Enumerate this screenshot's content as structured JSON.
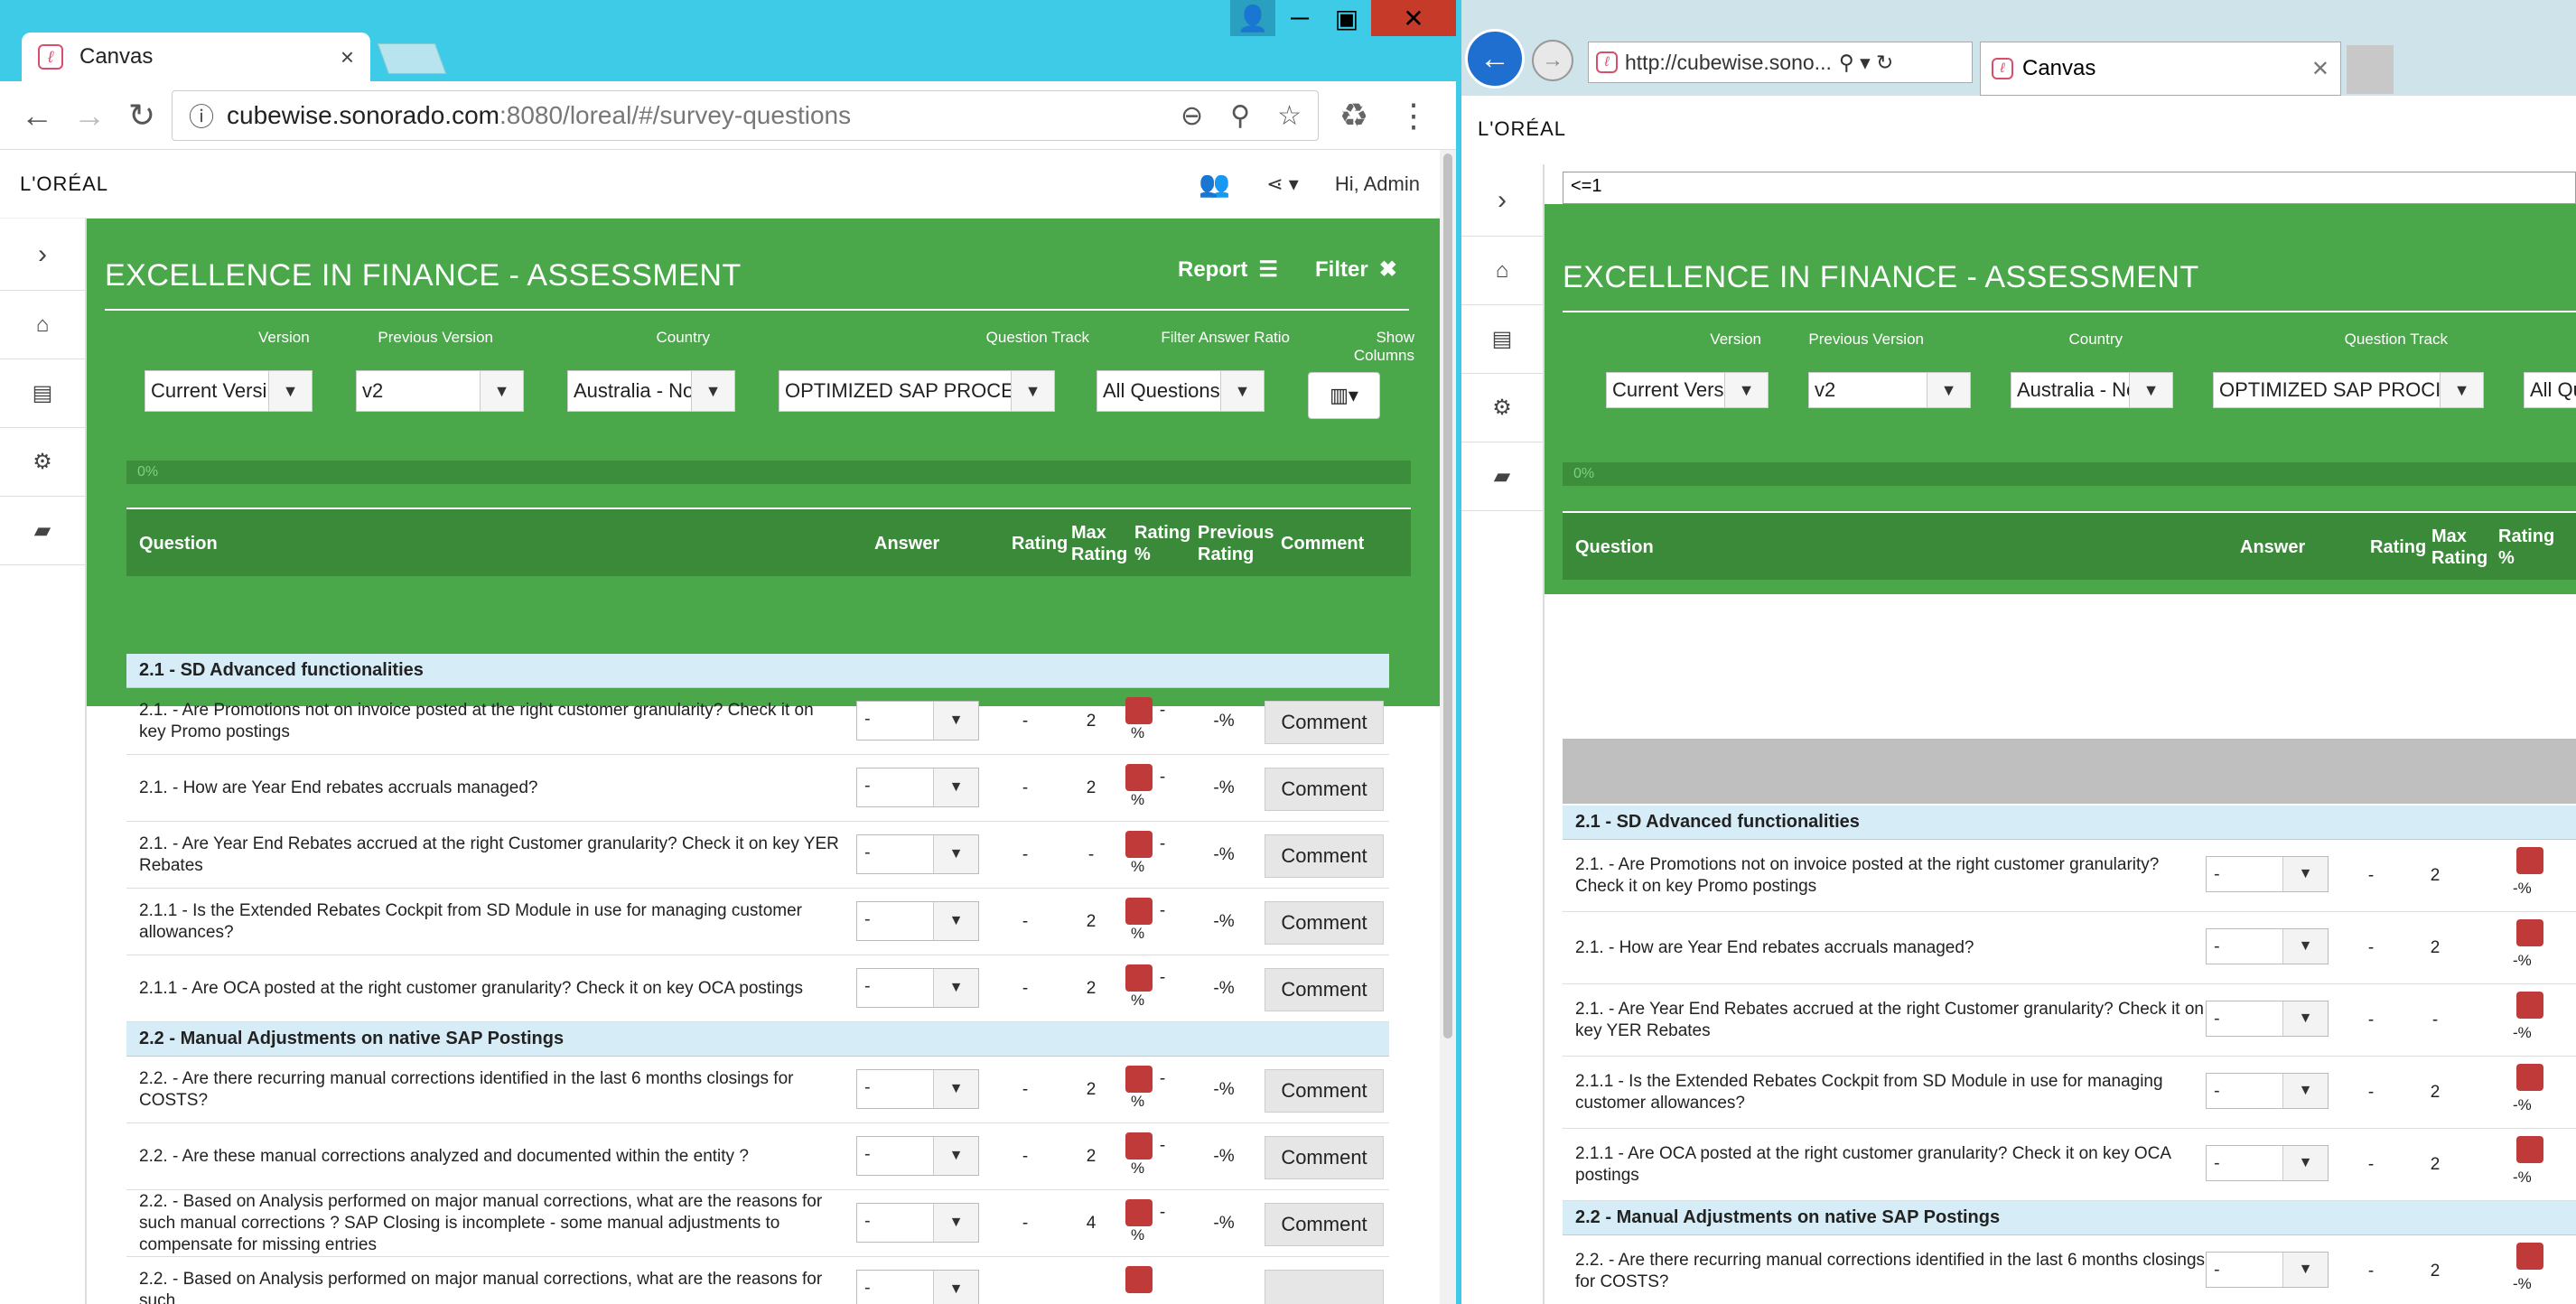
{
  "left_window": {
    "tab_title": "Canvas",
    "url_host": "cubewise.sonorado.com",
    "url_rest": ":8080/loreal/#/survey-questions"
  },
  "right_window": {
    "url": "http://cubewise.sono...",
    "tab_title": "Canvas",
    "formula": "<=1"
  },
  "app": {
    "brand": "L'ORÉAL",
    "greeting": "Hi, Admin",
    "title": "EXCELLENCE IN FINANCE - ASSESSMENT",
    "report_label": "Report",
    "filter_label": "Filter",
    "progress_text": "0%",
    "filters": [
      {
        "label": "Version",
        "value": "Current Versi",
        "value_r": "Current Vers"
      },
      {
        "label": "Previous Version",
        "value": "v2",
        "value_r": "v2"
      },
      {
        "label": "Country",
        "value": "Australia - No",
        "value_r": "Australia - Ne"
      },
      {
        "label": "Question Track",
        "value": "OPTIMIZED SAP PROCE",
        "value_r": "OPTIMIZED SAP PROCI"
      },
      {
        "label": "Filter Answer Ratio",
        "value": "All Questions",
        "value_r": "All Qu"
      },
      {
        "label": "Show Columns",
        "value": "▥▾"
      }
    ],
    "columns": {
      "question": "Question",
      "answer": "Answer",
      "rating": "Rating",
      "max_rating": "Max Rating",
      "rating_pct": "Rating %",
      "prev_rating": "Previous Rating",
      "comment": "Comment"
    },
    "sections": [
      {
        "title": "2.1 - SD Advanced functionalities"
      },
      {
        "title": "2.2 - Manual Adjustments on native SAP Postings"
      }
    ],
    "rows": [
      {
        "q": "2.1. - Are Promotions not on invoice posted at the right customer granularity? Check it on key Promo postings",
        "answer": "-",
        "rating": "-",
        "max": "2",
        "pct": "-",
        "pct_sub": "%",
        "prev": "-%",
        "comment": "Comment"
      },
      {
        "q": "2.1. - How are Year End rebates accruals managed?",
        "answer": "-",
        "rating": "-",
        "max": "2",
        "pct": "-",
        "pct_sub": "%",
        "prev": "-%",
        "comment": "Comment"
      },
      {
        "q": "2.1. - Are Year End Rebates accrued at the right Customer granularity? Check it on key YER Rebates",
        "answer": "-",
        "rating": "-",
        "max": "-",
        "pct": "-",
        "pct_sub": "%",
        "prev": "-%",
        "comment": "Comment"
      },
      {
        "q": "2.1.1 - Is the Extended Rebates Cockpit from SD Module in use for managing customer allowances?",
        "answer": "-",
        "rating": "-",
        "max": "2",
        "pct": "-",
        "pct_sub": "%",
        "prev": "-%",
        "comment": "Comment"
      },
      {
        "q": "2.1.1 - Are OCA posted at the right customer granularity? Check it on key OCA postings",
        "answer": "-",
        "rating": "-",
        "max": "2",
        "pct": "-",
        "pct_sub": "%",
        "prev": "-%",
        "comment": "Comment"
      },
      {
        "q": "2.2. - Are there recurring manual corrections identified in the last 6 months closings for COSTS?",
        "answer": "-",
        "rating": "-",
        "max": "2",
        "pct": "-",
        "pct_sub": "%",
        "prev": "-%",
        "comment": "Comment"
      },
      {
        "q": "2.2. - Are these manual corrections analyzed and documented within the entity ?",
        "answer": "-",
        "rating": "-",
        "max": "2",
        "pct": "-",
        "pct_sub": "%",
        "prev": "-%",
        "comment": "Comment"
      },
      {
        "q": "2.2. - Based on Analysis performed on major manual corrections, what are the reasons for such manual corrections ? SAP Closing is incomplete - some manual adjustments to compensate for missing entries",
        "answer": "-",
        "rating": "-",
        "max": "4",
        "pct": "-",
        "pct_sub": "%",
        "prev": "-%",
        "comment": "Comment"
      },
      {
        "q": "2.2. - Based on Analysis performed on major manual corrections, what are the reasons for such",
        "answer": "-",
        "rating": "",
        "max": "",
        "pct": "",
        "pct_sub": "",
        "prev": "",
        "comment": ""
      }
    ],
    "rows_r_q": [
      "2.1. - Are Promotions not on invoice posted at the right customer granularity? Check it on key Promo postings",
      "2.1. - How are Year End rebates accruals managed?",
      "2.1. - Are Year End Rebates accrued at the right Customer granularity? Check it on key YER Rebates",
      "2.1.1 - Is the Extended Rebates Cockpit from SD Module in use for managing customer allowances?",
      "2.1.1 - Are OCA posted at the right customer granularity? Check it on key OCA postings",
      "2.2. - Are there recurring manual corrections identified in the last 6 months closings for COSTS?"
    ],
    "rating_pct_r": "-%"
  }
}
